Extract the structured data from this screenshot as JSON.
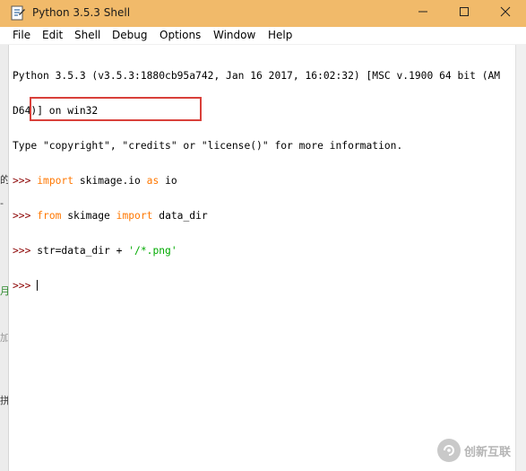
{
  "window": {
    "title": "Python 3.5.3 Shell",
    "icons": {
      "app": "python-idle-icon",
      "minimize": "minimize-icon",
      "maximize": "maximize-icon",
      "close": "close-icon"
    },
    "titlebar_color": "#f1ba6a"
  },
  "menu": {
    "items": [
      {
        "label": "File"
      },
      {
        "label": "Edit"
      },
      {
        "label": "Shell"
      },
      {
        "label": "Debug"
      },
      {
        "label": "Options"
      },
      {
        "label": "Window"
      },
      {
        "label": "Help"
      }
    ]
  },
  "shell": {
    "banner_line1": "Python 3.5.3 (v3.5.3:1880cb95a742, Jan 16 2017, 16:02:32) [MSC v.1900 64 bit (AM",
    "banner_line2": "D64)] on win32",
    "banner_line3": "Type \"copyright\", \"credits\" or \"license()\" for more information.",
    "prompt": ">>> ",
    "line1": {
      "kw1": "import",
      "rest": " skimage.io ",
      "kw2": "as",
      "tail": " io"
    },
    "line2": {
      "kw1": "from",
      "mid": " skimage ",
      "kw2": "import",
      "tail": " data_dir"
    },
    "line3": {
      "code": "str=data_dir + ",
      "string": "'/*.png'"
    },
    "colors": {
      "prompt": "#8b0000",
      "keyword": "#ff7700",
      "string": "#00aa00",
      "highlight": "#d9403a"
    }
  },
  "left_strip": {
    "marks": [
      "的",
      "-",
      "月",
      "加",
      "拼"
    ]
  },
  "watermark": {
    "text": "创新互联",
    "logo": "chuangxin-logo-icon"
  }
}
